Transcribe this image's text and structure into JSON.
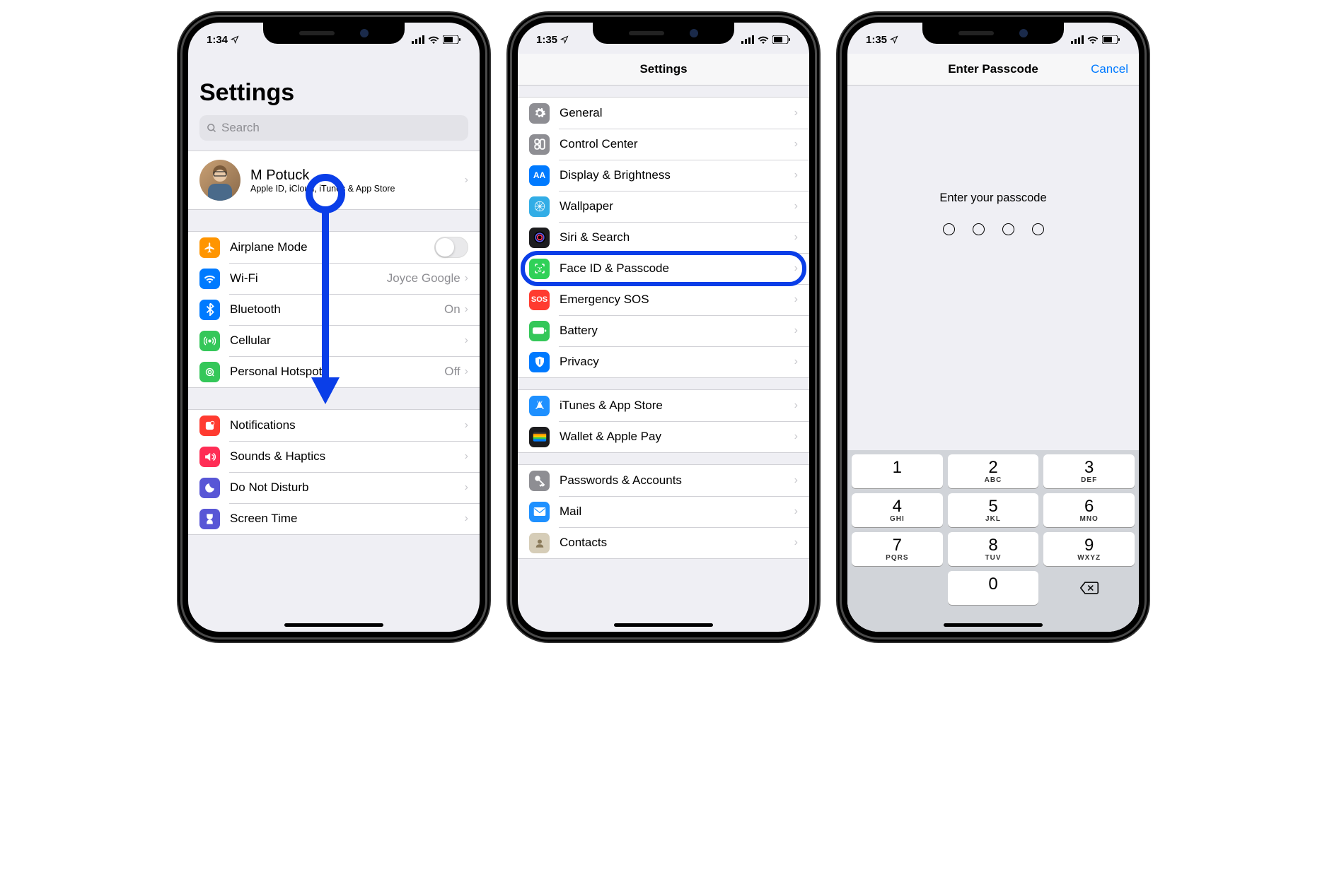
{
  "screen1": {
    "status_time": "1:34",
    "title": "Settings",
    "search_placeholder": "Search",
    "profile": {
      "name": "M Potuck",
      "sub": "Apple ID, iCloud, iTunes & App Store"
    },
    "group_a": [
      {
        "label": "Airplane Mode",
        "type": "toggle",
        "value": "off",
        "icon": "airplane-icon",
        "color": "#ff9500"
      },
      {
        "label": "Wi-Fi",
        "detail": "Joyce Google",
        "icon": "wifi-icon",
        "color": "#007aff"
      },
      {
        "label": "Bluetooth",
        "detail": "On",
        "icon": "bluetooth-icon",
        "color": "#007aff"
      },
      {
        "label": "Cellular",
        "icon": "cellular-icon",
        "color": "#34c759"
      },
      {
        "label": "Personal Hotspot",
        "detail": "Off",
        "icon": "hotspot-icon",
        "color": "#34c759"
      }
    ],
    "group_b": [
      {
        "label": "Notifications",
        "icon": "notifications-icon",
        "color": "#ff3b30"
      },
      {
        "label": "Sounds & Haptics",
        "icon": "sounds-icon",
        "color": "#ff2d55"
      },
      {
        "label": "Do Not Disturb",
        "icon": "dnd-icon",
        "color": "#5856d6"
      },
      {
        "label": "Screen Time",
        "icon": "screentime-icon",
        "color": "#5856d6"
      }
    ]
  },
  "screen2": {
    "status_time": "1:35",
    "nav_title": "Settings",
    "group_a": [
      {
        "label": "General",
        "icon": "gear-icon",
        "color": "#8e8e93"
      },
      {
        "label": "Control Center",
        "icon": "control-center-icon",
        "color": "#8e8e93"
      },
      {
        "label": "Display & Brightness",
        "icon": "display-icon",
        "color": "#007aff"
      },
      {
        "label": "Wallpaper",
        "icon": "wallpaper-icon",
        "color": "#32ade6"
      },
      {
        "label": "Siri & Search",
        "icon": "siri-icon",
        "color": "#1c1c1e"
      },
      {
        "label": "Face ID & Passcode",
        "icon": "faceid-icon",
        "color": "#30d158",
        "highlighted": true
      },
      {
        "label": "Emergency SOS",
        "icon": "sos-icon",
        "color": "#ff3b30"
      },
      {
        "label": "Battery",
        "icon": "battery-icon",
        "color": "#34c759"
      },
      {
        "label": "Privacy",
        "icon": "privacy-icon",
        "color": "#007aff"
      }
    ],
    "group_b": [
      {
        "label": "iTunes & App Store",
        "icon": "appstore-icon",
        "color": "#1e90ff"
      },
      {
        "label": "Wallet & Apple Pay",
        "icon": "wallet-icon",
        "color": "#1c1c1e"
      }
    ],
    "group_c": [
      {
        "label": "Passwords & Accounts",
        "icon": "key-icon",
        "color": "#8e8e93"
      },
      {
        "label": "Mail",
        "icon": "mail-icon",
        "color": "#1e90ff"
      },
      {
        "label": "Contacts",
        "icon": "contacts-icon",
        "color": "#d6cdb8"
      }
    ]
  },
  "screen3": {
    "status_time": "1:35",
    "nav_title": "Enter Passcode",
    "cancel": "Cancel",
    "prompt": "Enter your passcode",
    "passcode_length": 4,
    "keypad": [
      [
        {
          "n": "1",
          "l": ""
        },
        {
          "n": "2",
          "l": "ABC"
        },
        {
          "n": "3",
          "l": "DEF"
        }
      ],
      [
        {
          "n": "4",
          "l": "GHI"
        },
        {
          "n": "5",
          "l": "JKL"
        },
        {
          "n": "6",
          "l": "MNO"
        }
      ],
      [
        {
          "n": "7",
          "l": "PQRS"
        },
        {
          "n": "8",
          "l": "TUV"
        },
        {
          "n": "9",
          "l": "WXYZ"
        }
      ],
      [
        {
          "blank": true
        },
        {
          "n": "0",
          "l": ""
        },
        {
          "backspace": true
        }
      ]
    ]
  }
}
